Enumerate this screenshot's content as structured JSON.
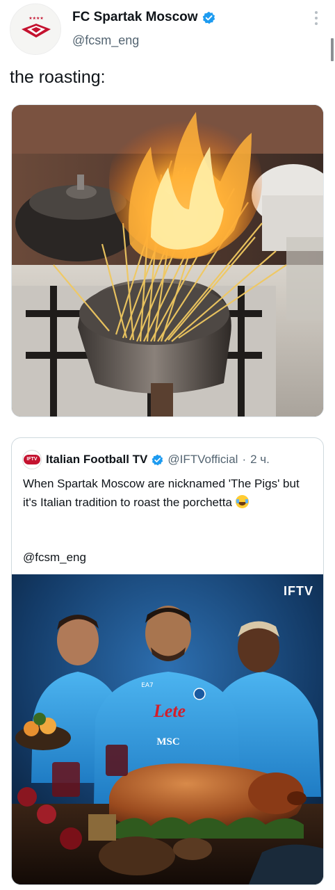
{
  "account": {
    "display_name": "FC Spartak Moscow",
    "handle": "@fcsm_eng",
    "verified": true,
    "avatar_icon": "spartak-crest-icon"
  },
  "tweet": {
    "text": "the roasting:",
    "photo_description_icon": "burning-spaghetti-photo"
  },
  "quoted_tweet": {
    "display_name": "Italian Football TV",
    "handle": "@IFTVofficial",
    "separator": "·",
    "time": "2 ч.",
    "avatar_text": "IFTV",
    "body": "When Spartak Moscow are nicknamed 'The Pigs' but it's Italian tradition to roast the porchetta",
    "emoji": "tears-of-joy-emoji",
    "mention": "@fcsm_eng",
    "image_badge": "IFTV",
    "jersey_sponsor": "Lete",
    "jersey_sub_sponsor": "MSC",
    "jersey_brand": "EA7"
  },
  "colors": {
    "verified_blue": "#1d9bf0",
    "secondary_text": "#536471",
    "spartak_red": "#c4122f",
    "napoli_blue": "#3aa0e0"
  }
}
